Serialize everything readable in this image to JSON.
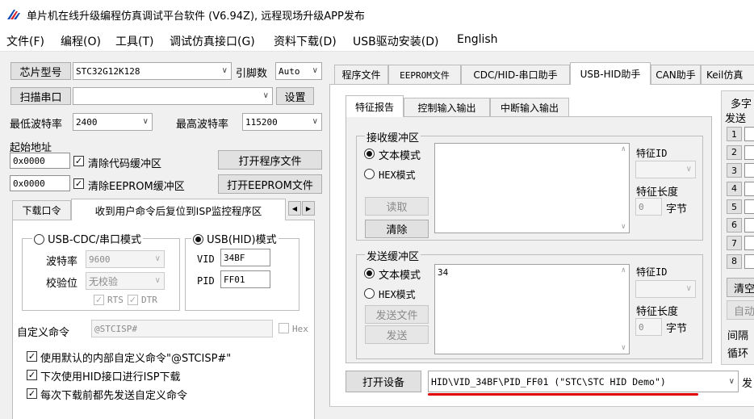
{
  "window": {
    "title": "单片机在线升级编程仿真调试平台软件 (V6.94Z), 远程现场升级APP发布"
  },
  "menu": [
    "文件(F)",
    "编程(O)",
    "工具(T)",
    "调试仿真接口(G)",
    "资料下载(D)",
    "USB驱动安装(D)",
    "English"
  ],
  "left": {
    "chip_btn": "芯片型号",
    "chip_value": "STC32G12K128",
    "pins_label": "引脚数",
    "pins_value": "Auto",
    "scan_btn": "扫描串口",
    "port_value": "",
    "settings_btn": "设置",
    "min_baud_label": "最低波特率",
    "min_baud_value": "2400",
    "max_baud_label": "最高波特率",
    "max_baud_value": "115200",
    "start_addr_label": "起始地址",
    "addr1": "0x0000",
    "clear_code": "清除代码缓冲区",
    "open_prog": "打开程序文件",
    "addr2": "0x0000",
    "clear_eeprom": "清除EEPROM缓冲区",
    "open_eeprom": "打开EEPROM文件",
    "tab_download_pwd": "下载口令",
    "tab_reset_isp": "收到用户命令后复位到ISP监控程序区",
    "mode_cdc": "USB-CDC/串口模式",
    "mode_hid": "USB(HID)模式",
    "baud_label": "波特率",
    "baud_value": "9600",
    "parity_label": "校验位",
    "parity_value": "无校验",
    "rts": "RTS",
    "dtr": "DTR",
    "vid_label": "VID",
    "vid_value": "34BF",
    "pid_label": "PID",
    "pid_value": "FF01",
    "custom_cmd_label": "自定义命令",
    "custom_cmd_value": "@STCISP#",
    "hex_label": "Hex",
    "opt1": "使用默认的内部自定义命令\"@STCISP#\"",
    "opt2": "下次使用HID接口进行ISP下载",
    "opt3": "每次下载前都先发送自定义命令"
  },
  "right": {
    "tabs": [
      "程序文件",
      "EEPROM文件",
      "CDC/HID-串口助手",
      "USB-HID助手",
      "CAN助手",
      "Keil仿真"
    ],
    "active_tab": "USB-HID助手",
    "sub_tabs": [
      "特征报告",
      "控制输入输出",
      "中断输入输出"
    ],
    "recv_group": "接收缓冲区",
    "text_mode": "文本模式",
    "hex_mode": "HEX模式",
    "read_btn": "读取",
    "clear_btn": "清除",
    "feature_id": "特征ID",
    "feature_len": "特征长度",
    "len_value": "0",
    "bytes": "字节",
    "send_group": "发送缓冲区",
    "send_text": "34",
    "send_file_btn": "发送文件",
    "send_btn": "发送",
    "multi_label": "多字",
    "send_label": "发送",
    "numbers": [
      "1",
      "2",
      "3",
      "4",
      "5",
      "6",
      "7",
      "8"
    ],
    "clear_side": "清空",
    "auto_side": "自动",
    "interval": "间隔",
    "loop": "循环",
    "open_device_btn": "打开设备",
    "device_value": "HID\\VID_34BF\\PID_FF01 (\"STC\\STC HID Demo\")",
    "send_trunc": "发"
  },
  "colors": {
    "highlight_underline": "#e00000"
  }
}
